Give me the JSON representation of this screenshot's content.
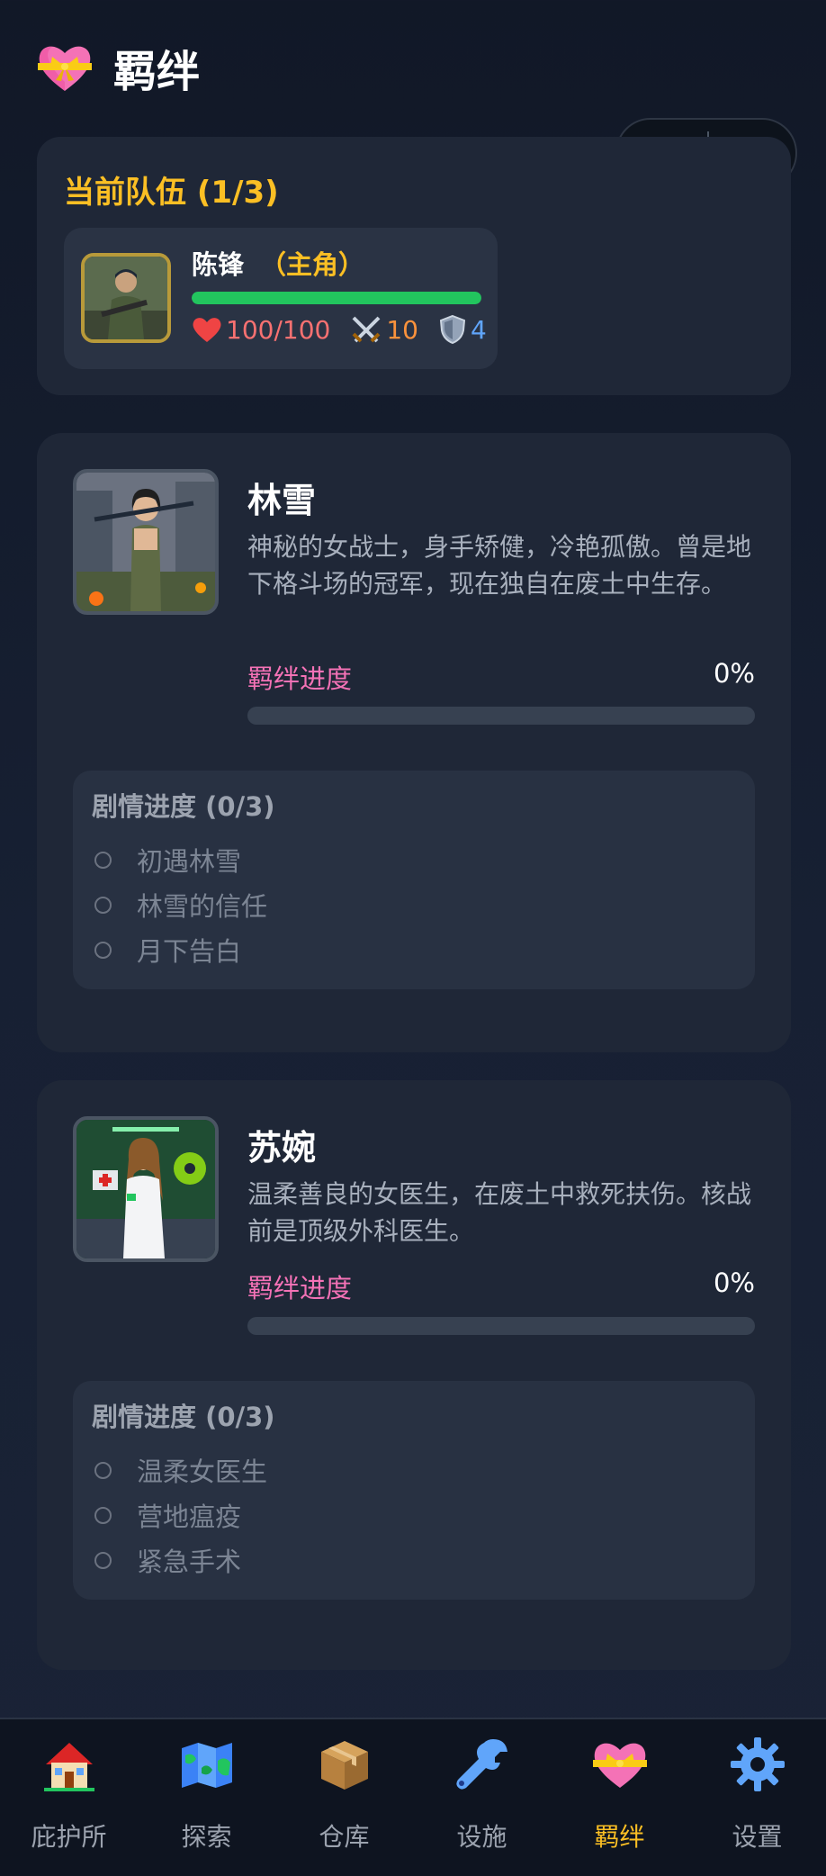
{
  "header": {
    "title": "羁绊",
    "icon": "heart-gift-icon"
  },
  "capsule": {
    "more_icon": "more-dots-icon",
    "target_icon": "target-icon"
  },
  "team": {
    "title": "当前队伍 (1/3)",
    "member": {
      "name": "陈锋",
      "role": "（主角）",
      "hp_fraction": 1.0,
      "hp": "100/100",
      "attack": "10",
      "defense": "4"
    }
  },
  "characters": [
    {
      "name": "林雪",
      "description": "神秘的女战士，身手矫健，冷艳孤傲。曾是地下格斗场的冠军，现在独自在废土中生存。",
      "bond_label": "羁绊进度",
      "bond_percent": "0%",
      "bond_value": 0,
      "story_title": "剧情进度 (0/3)",
      "story": [
        "初遇林雪",
        "林雪的信任",
        "月下告白"
      ]
    },
    {
      "name": "苏婉",
      "description": "温柔善良的女医生，在废土中救死扶伤。核战前是顶级外科医生。",
      "bond_label": "羁绊进度",
      "bond_percent": "0%",
      "bond_value": 0,
      "story_title": "剧情进度 (0/3)",
      "story": [
        "温柔女医生",
        "营地瘟疫",
        "紧急手术"
      ]
    }
  ],
  "tabs": [
    {
      "label": "庇护所",
      "icon": "house-icon",
      "active": false
    },
    {
      "label": "探索",
      "icon": "map-icon",
      "active": false
    },
    {
      "label": "仓库",
      "icon": "package-icon",
      "active": false
    },
    {
      "label": "设施",
      "icon": "wrench-icon",
      "active": false
    },
    {
      "label": "羁绊",
      "icon": "heart-gift-icon",
      "active": true
    },
    {
      "label": "设置",
      "icon": "gear-icon",
      "active": false
    }
  ],
  "colors": {
    "accent": "#fbbf24",
    "bond": "#f472b6",
    "hp": "#22c55e",
    "background": "#172033"
  }
}
